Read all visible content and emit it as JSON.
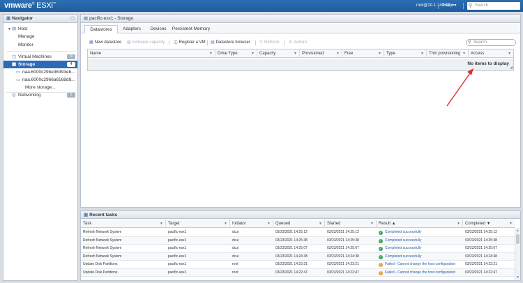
{
  "header": {
    "logo_brand": "vmware",
    "logo_product": "ESXi",
    "user": "root@10.1.149.41",
    "help": "Help",
    "search_placeholder": "Search"
  },
  "navigator": {
    "title": "Navigator",
    "items": [
      {
        "label": "Host",
        "icon": "host-icon"
      },
      {
        "label": "Manage"
      },
      {
        "label": "Monitor"
      },
      {
        "label": "Virtual Machines",
        "icon": "vm-icon",
        "count": "0"
      },
      {
        "label": "Storage",
        "icon": "storage-icon",
        "count": "4"
      },
      {
        "label": "naa.6000c29be36393eb...",
        "icon": "disk-icon"
      },
      {
        "label": "naa.6000c2966a6168d8...",
        "icon": "disk-icon"
      },
      {
        "label": "More storage..."
      },
      {
        "label": "Networking",
        "icon": "network-icon",
        "count": "1"
      }
    ]
  },
  "main": {
    "title": "pacific-esx1 - Storage",
    "tabs": [
      "Datastores",
      "Adapters",
      "Devices",
      "Persistent Memory"
    ],
    "toolbar": {
      "new_datastore": "New datastore",
      "increase_capacity": "Increase capacity",
      "register_vm": "Register a VM",
      "datastore_browser": "Datastore browser",
      "refresh": "Refresh",
      "actions": "Actions",
      "search_placeholder": "Search"
    },
    "columns": [
      "Name",
      "Drive Type",
      "Capacity",
      "Provisioned",
      "Free",
      "Type",
      "Thin provisioning",
      "Access"
    ],
    "empty_text": "No items to display"
  },
  "tasks": {
    "title": "Recent tasks",
    "columns": [
      "Task",
      "Target",
      "Initiator",
      "Queued",
      "Started",
      "Result ▲",
      "Completed ▼"
    ],
    "rows": [
      {
        "task": "Refresh Network System",
        "target": "pacific-esx1",
        "initiator": "dcui",
        "queued": "03/23/2021 14:25:12",
        "started": "03/23/2021 14:25:12",
        "result": "Completed successfully",
        "status": "ok",
        "completed": "03/23/2021 14:25:12"
      },
      {
        "task": "Refresh Network System",
        "target": "pacific-esx1",
        "initiator": "dcui",
        "queued": "03/23/2021 14:25:38",
        "started": "03/23/2021 14:25:38",
        "result": "Completed successfully",
        "status": "ok",
        "completed": "03/23/2021 14:25:38"
      },
      {
        "task": "Refresh Network System",
        "target": "pacific-esx1",
        "initiator": "dcui",
        "queued": "03/23/2021 14:25:07",
        "started": "03/23/2021 14:25:07",
        "result": "Completed successfully",
        "status": "ok",
        "completed": "03/23/2021 14:25:07"
      },
      {
        "task": "Refresh Network System",
        "target": "pacific-esx1",
        "initiator": "dcui",
        "queued": "03/23/2021 14:24:38",
        "started": "03/23/2021 14:24:38",
        "result": "Completed successfully",
        "status": "ok",
        "completed": "03/23/2021 14:24:38"
      },
      {
        "task": "Update Disk Partitions",
        "target": "pacific-esx1",
        "initiator": "root",
        "queued": "03/23/2021 14:23:21",
        "started": "03/23/2021 14:23:21",
        "result": "Failed - Cannot change the host configuration",
        "status": "warn",
        "completed": "03/23/2021 14:23:21"
      },
      {
        "task": "Update Disk Partitions",
        "target": "pacific-esx1",
        "initiator": "root",
        "queued": "03/23/2021 14:22:47",
        "started": "03/23/2021 14:22:47",
        "result": "Failed - Cannot change the host configuration",
        "status": "warn",
        "completed": "03/23/2021 14:22:47"
      }
    ]
  },
  "colors": {
    "header_blue": "#1f5c9e",
    "selection_blue": "#2d6cb5",
    "success_green": "#3aa35a",
    "warning_orange": "#f0a030",
    "annotation_red": "#d9302c"
  }
}
